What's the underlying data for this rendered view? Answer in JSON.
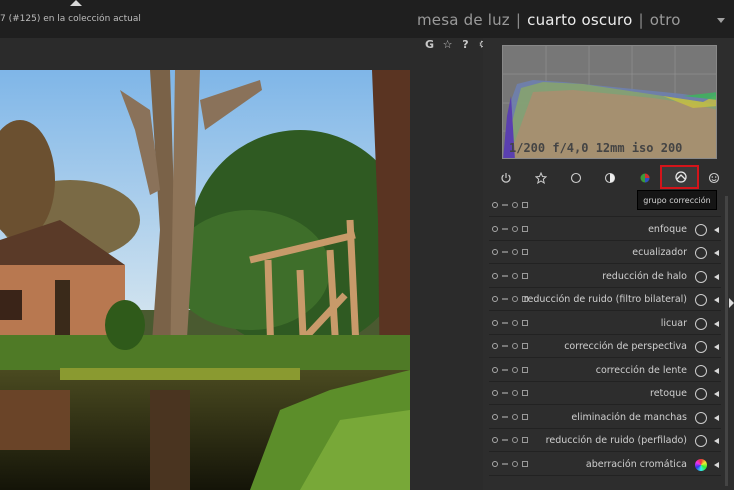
{
  "header": {
    "collection_info": "7 (#125) en la colección actual",
    "views": [
      {
        "label": "mesa de luz",
        "active": false
      },
      {
        "label": "cuarto oscuro",
        "active": true
      },
      {
        "label": "otro",
        "active": false
      }
    ],
    "quick_icons": [
      "G",
      "☆",
      "?",
      "⚙"
    ]
  },
  "histogram": {
    "exif": "1/200 f/4,0 12mm iso 200"
  },
  "groups": {
    "icons": [
      "power-icon",
      "star-icon",
      "circle-icon",
      "half-circle-icon",
      "color-icon",
      "correction-icon",
      "effects-icon"
    ],
    "active": "correction-icon",
    "tooltip": "grupo corrección"
  },
  "modules": [
    {
      "label": "",
      "icon": "none"
    },
    {
      "label": "enfoque",
      "icon": "sharpen-icon"
    },
    {
      "label": "ecualizador",
      "icon": "equalizer-icon"
    },
    {
      "label": "reducción de halo",
      "icon": "circle-icon"
    },
    {
      "label": "reducción de ruido (filtro bilateral)",
      "icon": "denoise-icon"
    },
    {
      "label": "licuar",
      "icon": "liquify-icon"
    },
    {
      "label": "corrección de perspectiva",
      "icon": "perspective-icon"
    },
    {
      "label": "corrección de lente",
      "icon": "lens-icon"
    },
    {
      "label": "retoque",
      "icon": "circle-icon"
    },
    {
      "label": "eliminación de manchas",
      "icon": "spot-icon"
    },
    {
      "label": "reducción de ruido (perfilado)",
      "icon": "circle-icon"
    },
    {
      "label": "aberración cromática",
      "icon": "chroma-icon"
    }
  ],
  "colors": {
    "accent_active_border": "#d4141a",
    "panel_bg": "#2d2d2d",
    "topbar_bg": "#1f1f1f"
  }
}
